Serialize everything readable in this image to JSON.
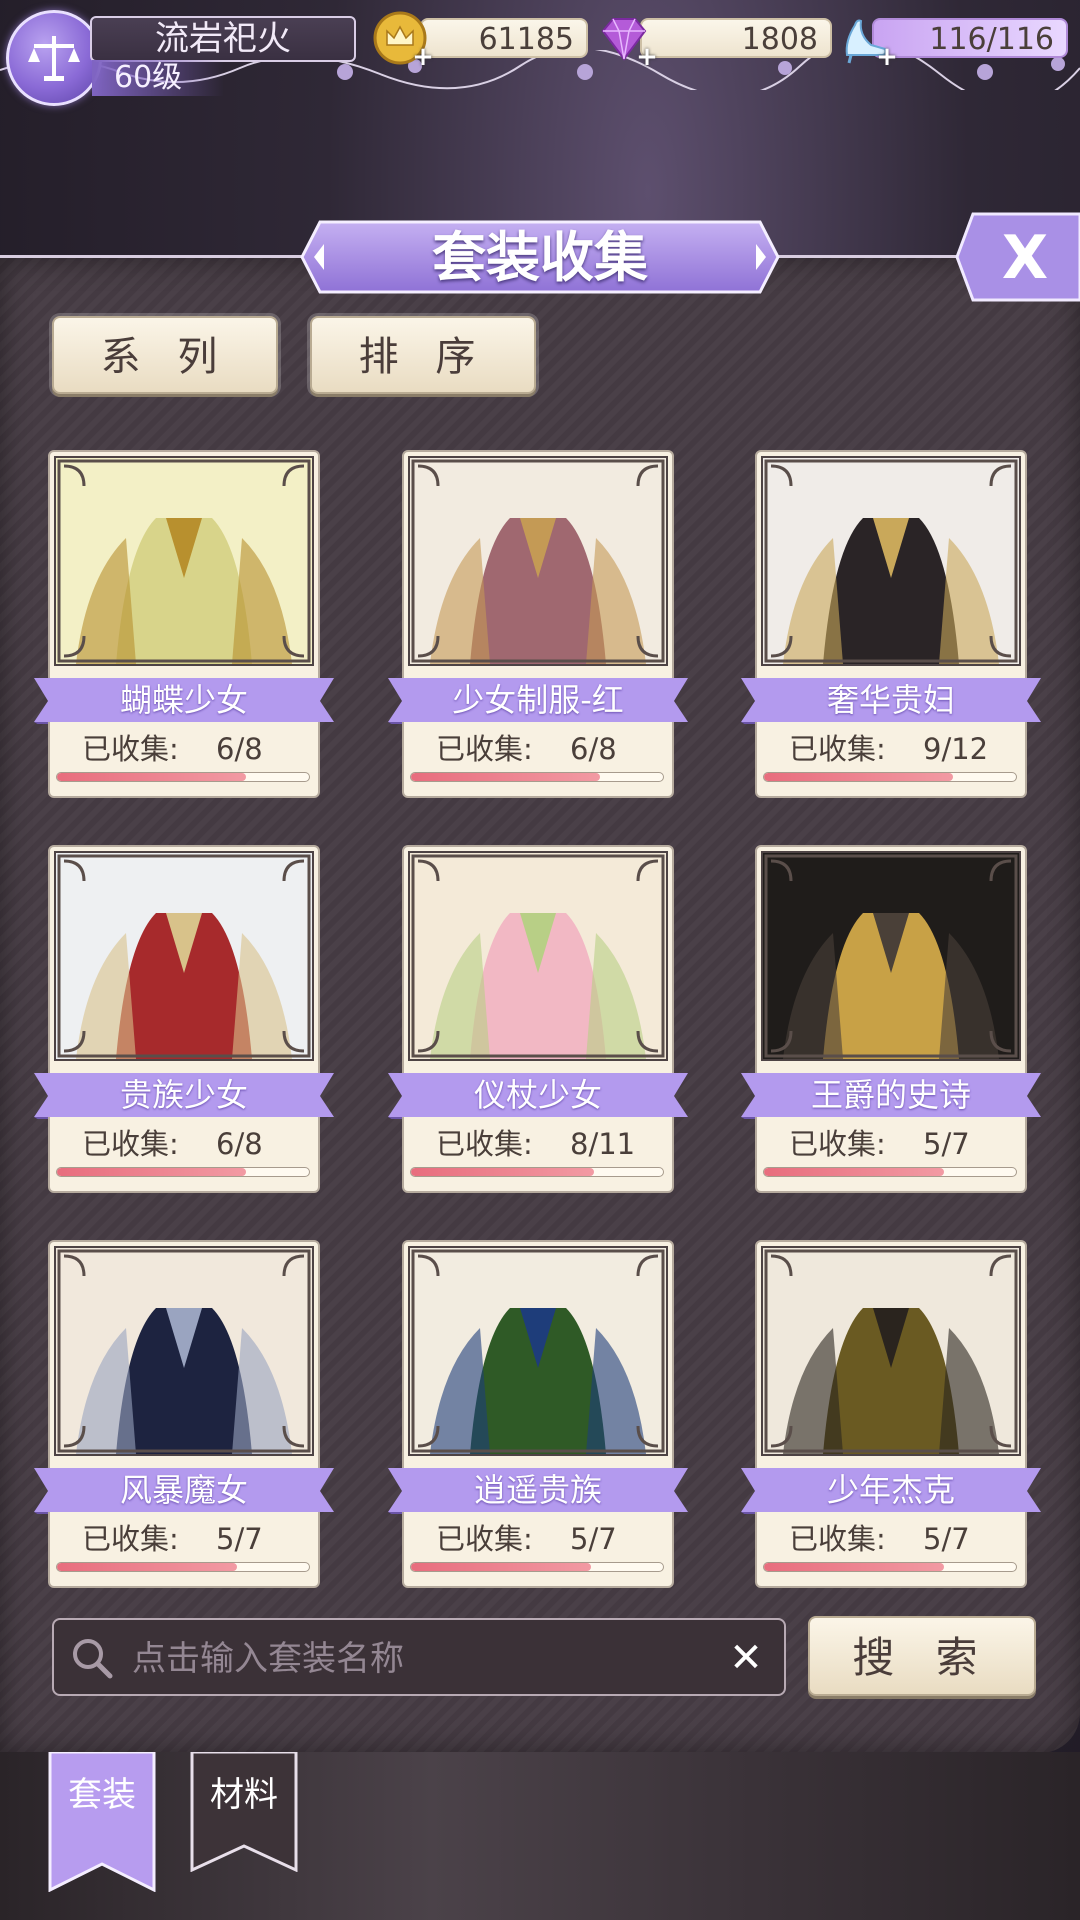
{
  "player": {
    "name": "流岩祀火",
    "level": "60级"
  },
  "resources": {
    "gold": "61185",
    "diamond": "1808",
    "stamina": "116/116",
    "plus_symbol": "+"
  },
  "title": "套装收集",
  "close_symbol": "X",
  "filters": {
    "series_label": "系 列",
    "sort_label": "排 序"
  },
  "collected_label": "已收集:",
  "suits": [
    {
      "name": "蝴蝶少女",
      "count": "6/8",
      "progress": 0.75,
      "colors": [
        "#f3f0c6",
        "#d8d48a",
        "#b8902e"
      ]
    },
    {
      "name": "少女制服-红",
      "count": "6/8",
      "progress": 0.75,
      "colors": [
        "#f2ebe0",
        "#a06870",
        "#c49a55"
      ]
    },
    {
      "name": "奢华贵妇",
      "count": "9/12",
      "progress": 0.75,
      "colors": [
        "#f0ece8",
        "#2a2426",
        "#c9a85a"
      ]
    },
    {
      "name": "贵族少女",
      "count": "6/8",
      "progress": 0.75,
      "colors": [
        "#eef0f2",
        "#a72a2c",
        "#d8c28a"
      ]
    },
    {
      "name": "仪杖少女",
      "count": "8/11",
      "progress": 0.7273,
      "colors": [
        "#f4ead8",
        "#f2b8c4",
        "#b8cf86"
      ]
    },
    {
      "name": "王爵的史诗",
      "count": "5/7",
      "progress": 0.7143,
      "colors": [
        "#1f1c1a",
        "#c8a146",
        "#4a4038"
      ]
    },
    {
      "name": "风暴魔女",
      "count": "5/7",
      "progress": 0.7143,
      "colors": [
        "#f1e8dc",
        "#1d2340",
        "#9aa4c0"
      ]
    },
    {
      "name": "逍遥贵族",
      "count": "5/7",
      "progress": 0.7143,
      "colors": [
        "#f2ece0",
        "#2f5a26",
        "#1e3d7a"
      ]
    },
    {
      "name": "少年杰克",
      "count": "5/7",
      "progress": 0.7143,
      "colors": [
        "#efe8dc",
        "#6a5a22",
        "#2a241e"
      ]
    }
  ],
  "search": {
    "placeholder": "点击输入套装名称",
    "clear_symbol": "✕",
    "button_label": "搜 索"
  },
  "tabs": [
    {
      "label": "套装",
      "active": true
    },
    {
      "label": "材料",
      "active": false
    }
  ],
  "theme": {
    "accent_purple": "#a98ee8",
    "progress_pink": "#e86d7d",
    "card_bg": "#f8f1e2"
  }
}
